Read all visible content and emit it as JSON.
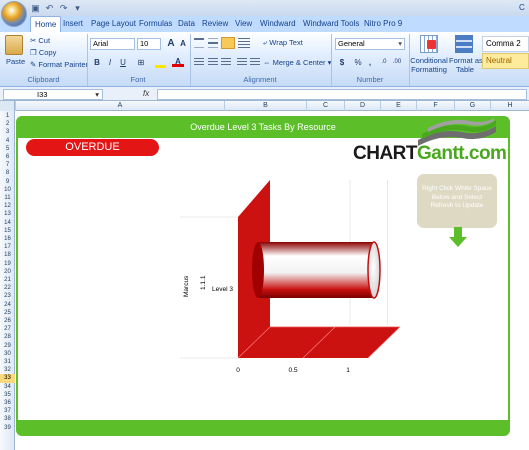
{
  "window": {
    "title_fragment": "C"
  },
  "tabs": [
    "Home",
    "Insert",
    "Page Layout",
    "Formulas",
    "Data",
    "Review",
    "View",
    "Windward",
    "Windward Tools",
    "Nitro Pro 9"
  ],
  "ribbon": {
    "clipboard": {
      "paste": "Paste",
      "cut": "Cut",
      "copy": "Copy",
      "format_painter": "Format Painter",
      "label": "Clipboard"
    },
    "font": {
      "name": "Arial",
      "size": "10",
      "label": "Font",
      "grow": "A",
      "shrink": "A",
      "bold": "B",
      "italic": "I",
      "underline": "U"
    },
    "alignment": {
      "wrap_text": "Wrap Text",
      "merge_center": "Merge & Center",
      "label": "Alignment"
    },
    "number": {
      "format": "General",
      "currency": "$",
      "percent": "%",
      "comma": ",",
      "label": "Number"
    },
    "styles": {
      "conditional": "Conditional",
      "conditional2": "Formatting",
      "format_as": "Format as",
      "format_as2": "Table",
      "comma2": "Comma 2",
      "neutral": "Neutral"
    }
  },
  "formula_bar": {
    "name_box": "I33",
    "fx": "fx",
    "value": ""
  },
  "columns": [
    "A",
    "B",
    "C",
    "D",
    "E",
    "F",
    "G",
    "H"
  ],
  "rows": [
    "1",
    "2",
    "3",
    "4",
    "5",
    "6",
    "7",
    "8",
    "9",
    "10",
    "11",
    "12",
    "13",
    "14",
    "15",
    "16",
    "17",
    "18",
    "19",
    "20",
    "21",
    "22",
    "23",
    "24",
    "25",
    "26",
    "27",
    "28",
    "29",
    "30",
    "31",
    "32",
    "33",
    "34",
    "35",
    "36",
    "37",
    "38",
    "39"
  ],
  "selected_row": "33",
  "sheet": {
    "title": "Overdue Level 3 Tasks By Resource",
    "overdue_badge": "OVERDUE",
    "brand_part1": "CHART",
    "brand_part2": "Gantt.com",
    "hint": "Right Click White Space Below and Select Refresh to Update"
  },
  "colors": {
    "green": "#5cbf2a",
    "red": "#e31515",
    "bar": "#cc1111"
  },
  "chart_data": {
    "type": "bar",
    "orientation": "horizontal",
    "categories": [
      "Level 3"
    ],
    "category_groups": [
      "Marcus",
      "1.1.1"
    ],
    "values": [
      1
    ],
    "xlim": [
      0,
      1
    ],
    "x_ticks": [
      "0",
      "0.5",
      "1"
    ],
    "grid": true,
    "title": ""
  }
}
